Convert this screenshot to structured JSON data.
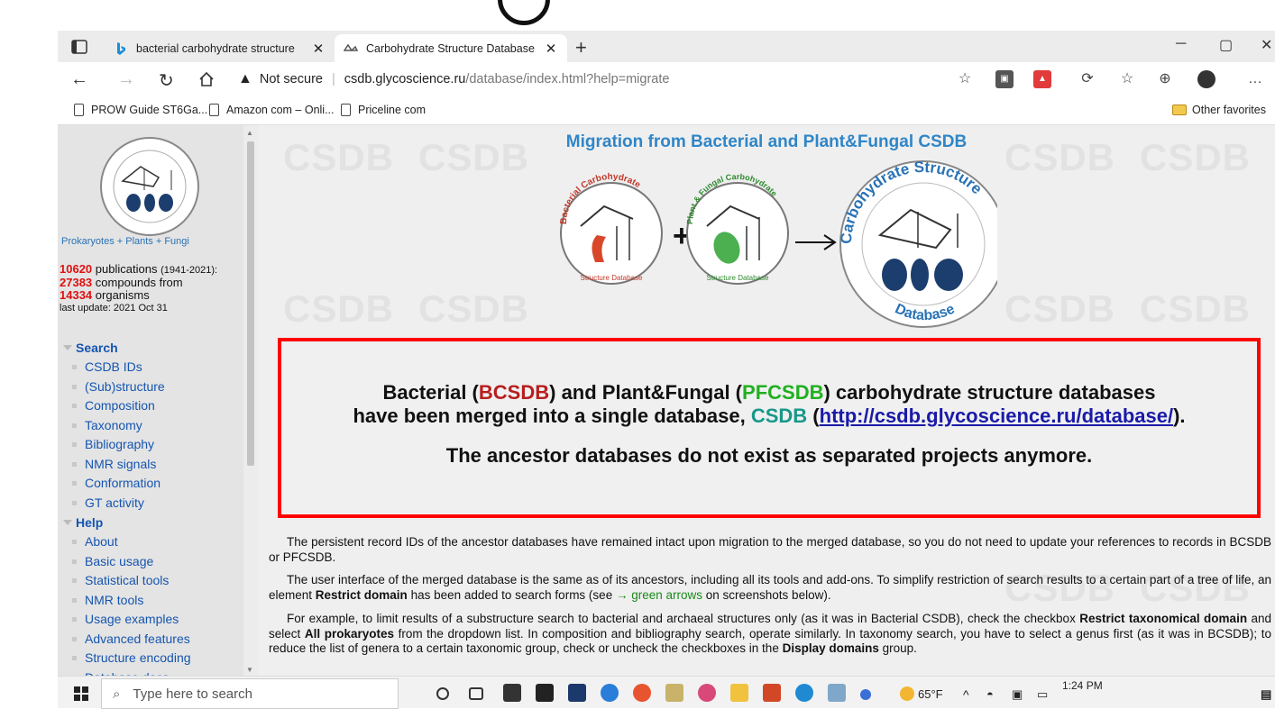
{
  "tabs": [
    {
      "title": "bacterial carbohydrate structure",
      "active": false,
      "favicon": "bing-icon"
    },
    {
      "title": "Carbohydrate Structure Database",
      "active": true,
      "favicon": "csdb-icon"
    }
  ],
  "address": {
    "security_label": "Not secure",
    "url_host": "csdb.glycoscience.ru",
    "url_path": "/database/index.html?help=migrate"
  },
  "bookmarks": [
    "PROW Guide ST6Ga...",
    "Amazon com – Onli...",
    "Priceline com"
  ],
  "other_favorites": "Other favorites",
  "sidebar": {
    "caption": "Prokaryotes + Plants + Fungi",
    "stats": {
      "publications_count": "10620",
      "publications_label": "publications",
      "years": "(1941-2021):",
      "compounds_count": "27383",
      "compounds_label": "compounds from",
      "organisms_count": "14334",
      "organisms_label": "organisms",
      "last_update": "last update: 2021 Oct 31"
    },
    "search_heading": "Search",
    "search_items": [
      "CSDB IDs",
      "(Sub)structure",
      "Composition",
      "Taxonomy",
      "Bibliography",
      "NMR signals",
      "Conformation",
      "GT activity"
    ],
    "help_heading": "Help",
    "help_items": [
      "About",
      "Basic usage",
      "Statistical tools",
      "NMR tools",
      "Usage examples",
      "Advanced features",
      "Structure encoding",
      "Database docs"
    ]
  },
  "main": {
    "title": "Migration from Bacterial and Plant&Fungal CSDB",
    "watermark": "CSDB",
    "logo_text": {
      "big_top": "Carbohydrate Structure",
      "big_bottom": "Database",
      "bacterial": "Bacterial Carbohydrate",
      "plant": "Plant & Fungal Carbohydrate",
      "structure_db": "Structure Database"
    },
    "notice": {
      "l1_a": "Bacterial (",
      "l1_b": "BCSDB",
      "l1_c": ") and Plant&Fungal (",
      "l1_d": "PFCSDB",
      "l1_e": ") carbohydrate structure databases",
      "l2_a": "have been merged into a single database, ",
      "l2_b": "CSDB",
      "l2_c": " (",
      "l2_link": "http://csdb.glycoscience.ru/database/",
      "l2_d": ").",
      "l3": "The ancestor databases do not exist as separated projects anymore."
    },
    "para1": "The persistent record IDs of the ancestor databases have remained intact upon migration to the merged database, so you do not need to update your references to records in BCSDB or PFCSDB.",
    "para2_a": "The user interface of the merged database is the same as of its ancestors, including all its tools and add-ons. To simplify restriction of search results to a certain part of a tree of life, an element ",
    "para2_b": "Restrict domain",
    "para2_c": " has been added to search forms (see ",
    "para2_d": "→ green arrows",
    "para2_e": " on screenshots below).",
    "para3_a": "For example, to limit results of a substructure search to bacterial and archaeal structures only (as it was in Bacterial CSDB), check the checkbox ",
    "para3_b": "Restrict taxonomical domain",
    "para3_c": " and select ",
    "para3_d": "All prokaryotes",
    "para3_e": " from the dropdown list. In composition and bibliography search, operate similarly. In taxonomy search, you have to select a genus first (as it was in BCSDB); to reduce the list of genera to a certain taxonomic group, check or uncheck the checkboxes in the ",
    "para3_f": "Display domains",
    "para3_g": " group."
  },
  "taskbar": {
    "search_placeholder": "Type here to search",
    "weather": "65°F",
    "time": "1:24 PM"
  },
  "colors": {
    "accent_title": "#2f86c8",
    "notice_border": "#ff0000",
    "stat_red": "#e01010",
    "menu_link": "#1555b0"
  }
}
